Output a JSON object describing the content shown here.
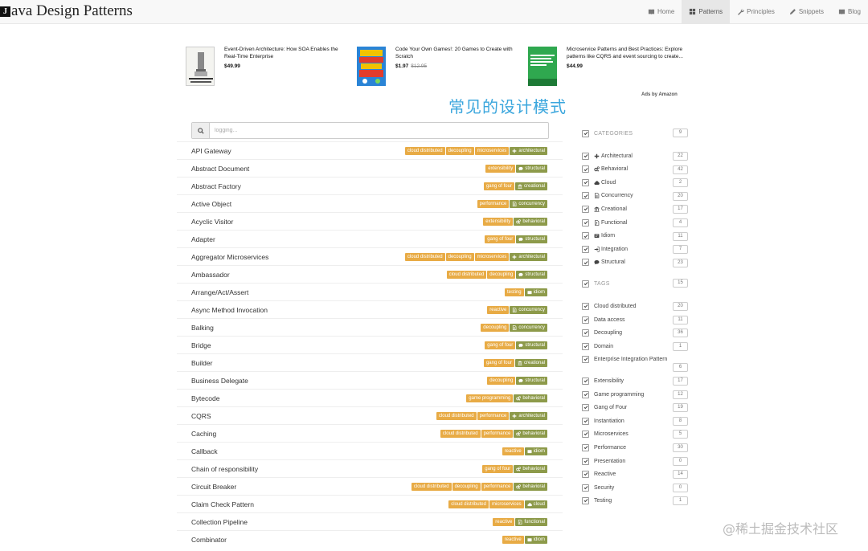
{
  "brand": {
    "logo_glyph": "J",
    "name": "ava Design Patterns"
  },
  "nav": [
    {
      "label": "Home",
      "icon": "book-icon",
      "active": false
    },
    {
      "label": "Patterns",
      "icon": "grid-icon",
      "active": true
    },
    {
      "label": "Principles",
      "icon": "wrench-icon",
      "active": false
    },
    {
      "label": "Snippets",
      "icon": "pencil-icon",
      "active": false
    },
    {
      "label": "Blog",
      "icon": "book-icon",
      "active": false
    }
  ],
  "ads": [
    {
      "title": "Event-Driven Architecture: How SOA Enables the Real-Time Enterprise",
      "price": "$49.99",
      "old_price": "",
      "cover_text": "EVENT-DRIVEN ARCHITECTURE"
    },
    {
      "title": "Code Your Own Games!: 20 Games to Create with Scratch",
      "price": "$1.97",
      "old_price": "$12.95",
      "cover_text": "CODE YOUR OWN GAMES!"
    },
    {
      "title": "Microservice Patterns and Best Practices: Explore patterns like CQRS and event sourcing to create...",
      "price": "$44.99",
      "old_price": "",
      "cover_text": "Microservice Patterns and Best Practices"
    }
  ],
  "ads_by": "Ads by Amazon",
  "page_title": "常见的设计模式",
  "search": {
    "placeholder": "logging..."
  },
  "patterns": [
    {
      "name": "API Gateway",
      "tags": [
        "cloud distributed",
        "decoupling",
        "microservices"
      ],
      "category": {
        "label": "architectural",
        "icon": "plus-icon"
      }
    },
    {
      "name": "Abstract Document",
      "tags": [
        "extensibility"
      ],
      "category": {
        "label": "structural",
        "icon": "comment-icon"
      }
    },
    {
      "name": "Abstract Factory",
      "tags": [
        "gang of four"
      ],
      "category": {
        "label": "creational",
        "icon": "bank-icon"
      }
    },
    {
      "name": "Active Object",
      "tags": [
        "performance"
      ],
      "category": {
        "label": "concurrency",
        "icon": "doc-icon"
      }
    },
    {
      "name": "Acyclic Visitor",
      "tags": [
        "extensibility"
      ],
      "category": {
        "label": "behavioral",
        "icon": "gears-icon"
      }
    },
    {
      "name": "Adapter",
      "tags": [
        "gang of four"
      ],
      "category": {
        "label": "structural",
        "icon": "comment-icon"
      }
    },
    {
      "name": "Aggregator Microservices",
      "tags": [
        "cloud distributed",
        "decoupling",
        "microservices"
      ],
      "category": {
        "label": "architectural",
        "icon": "plus-icon"
      }
    },
    {
      "name": "Ambassador",
      "tags": [
        "cloud distributed",
        "decoupling"
      ],
      "category": {
        "label": "structural",
        "icon": "comment-icon"
      }
    },
    {
      "name": "Arrange/Act/Assert",
      "tags": [
        "testing"
      ],
      "category": {
        "label": "idiom",
        "icon": "idiom-icon"
      }
    },
    {
      "name": "Async Method Invocation",
      "tags": [
        "reactive"
      ],
      "category": {
        "label": "concurrency",
        "icon": "doc-icon"
      }
    },
    {
      "name": "Balking",
      "tags": [
        "decoupling"
      ],
      "category": {
        "label": "concurrency",
        "icon": "doc-icon"
      }
    },
    {
      "name": "Bridge",
      "tags": [
        "gang of four"
      ],
      "category": {
        "label": "structural",
        "icon": "comment-icon"
      }
    },
    {
      "name": "Builder",
      "tags": [
        "gang of four"
      ],
      "category": {
        "label": "creational",
        "icon": "bank-icon"
      }
    },
    {
      "name": "Business Delegate",
      "tags": [
        "decoupling"
      ],
      "category": {
        "label": "structural",
        "icon": "comment-icon"
      }
    },
    {
      "name": "Bytecode",
      "tags": [
        "game programming"
      ],
      "category": {
        "label": "behavioral",
        "icon": "gears-icon"
      }
    },
    {
      "name": "CQRS",
      "tags": [
        "cloud distributed",
        "performance"
      ],
      "category": {
        "label": "architectural",
        "icon": "plus-icon"
      }
    },
    {
      "name": "Caching",
      "tags": [
        "cloud distributed",
        "performance"
      ],
      "category": {
        "label": "behavioral",
        "icon": "gears-icon"
      }
    },
    {
      "name": "Callback",
      "tags": [
        "reactive"
      ],
      "category": {
        "label": "idiom",
        "icon": "idiom-icon"
      }
    },
    {
      "name": "Chain of responsibility",
      "tags": [
        "gang of four"
      ],
      "category": {
        "label": "behavioral",
        "icon": "gears-icon"
      }
    },
    {
      "name": "Circuit Breaker",
      "tags": [
        "cloud distributed",
        "decoupling",
        "performance"
      ],
      "category": {
        "label": "behavioral",
        "icon": "gears-icon"
      }
    },
    {
      "name": "Claim Check Pattern",
      "tags": [
        "cloud distributed",
        "microservices"
      ],
      "category": {
        "label": "cloud",
        "icon": "cloud-icon"
      }
    },
    {
      "name": "Collection Pipeline",
      "tags": [
        "reactive"
      ],
      "category": {
        "label": "functional",
        "icon": "func-icon"
      }
    },
    {
      "name": "Combinator",
      "tags": [
        "reactive"
      ],
      "category": {
        "label": "idiom",
        "icon": "idiom-icon"
      }
    }
  ],
  "sidebar": {
    "categories_heading": "CATEGORIES",
    "categories_count": "9",
    "categories": [
      {
        "label": "Architectural",
        "icon": "plus-icon",
        "count": "22"
      },
      {
        "label": "Behavioral",
        "icon": "gears-icon",
        "count": "42"
      },
      {
        "label": "Cloud",
        "icon": "cloud-icon",
        "count": "2"
      },
      {
        "label": "Concurrency",
        "icon": "doc-icon",
        "count": "20"
      },
      {
        "label": "Creational",
        "icon": "bank-icon",
        "count": "17"
      },
      {
        "label": "Functional",
        "icon": "func-icon",
        "count": "4"
      },
      {
        "label": "Idiom",
        "icon": "idiom-icon",
        "count": "11"
      },
      {
        "label": "Integration",
        "icon": "signin-icon",
        "count": "7"
      },
      {
        "label": "Structural",
        "icon": "comment-icon",
        "count": "23"
      }
    ],
    "tags_heading": "TAGS",
    "tags_count": "15",
    "tags": [
      {
        "label": "Cloud distributed",
        "count": "20"
      },
      {
        "label": "Data access",
        "count": "11"
      },
      {
        "label": "Decoupling",
        "count": "36"
      },
      {
        "label": "Domain",
        "count": "1"
      },
      {
        "label": "Enterprise Integration Pattern",
        "count": "6"
      },
      {
        "label": "Extensibility",
        "count": "17"
      },
      {
        "label": "Game programming",
        "count": "12"
      },
      {
        "label": "Gang of Four",
        "count": "19"
      },
      {
        "label": "Instantiation",
        "count": "8"
      },
      {
        "label": "Microservices",
        "count": "5"
      },
      {
        "label": "Performance",
        "count": "30"
      },
      {
        "label": "Presentation",
        "count": "0"
      },
      {
        "label": "Reactive",
        "count": "14"
      },
      {
        "label": "Security",
        "count": "0"
      },
      {
        "label": "Testing",
        "count": "1"
      }
    ]
  },
  "watermark": "@稀土掘金技术社区",
  "colors": {
    "tag": "#e8ab45",
    "category": "#8d9a4a",
    "title": "#3aa6dd"
  }
}
